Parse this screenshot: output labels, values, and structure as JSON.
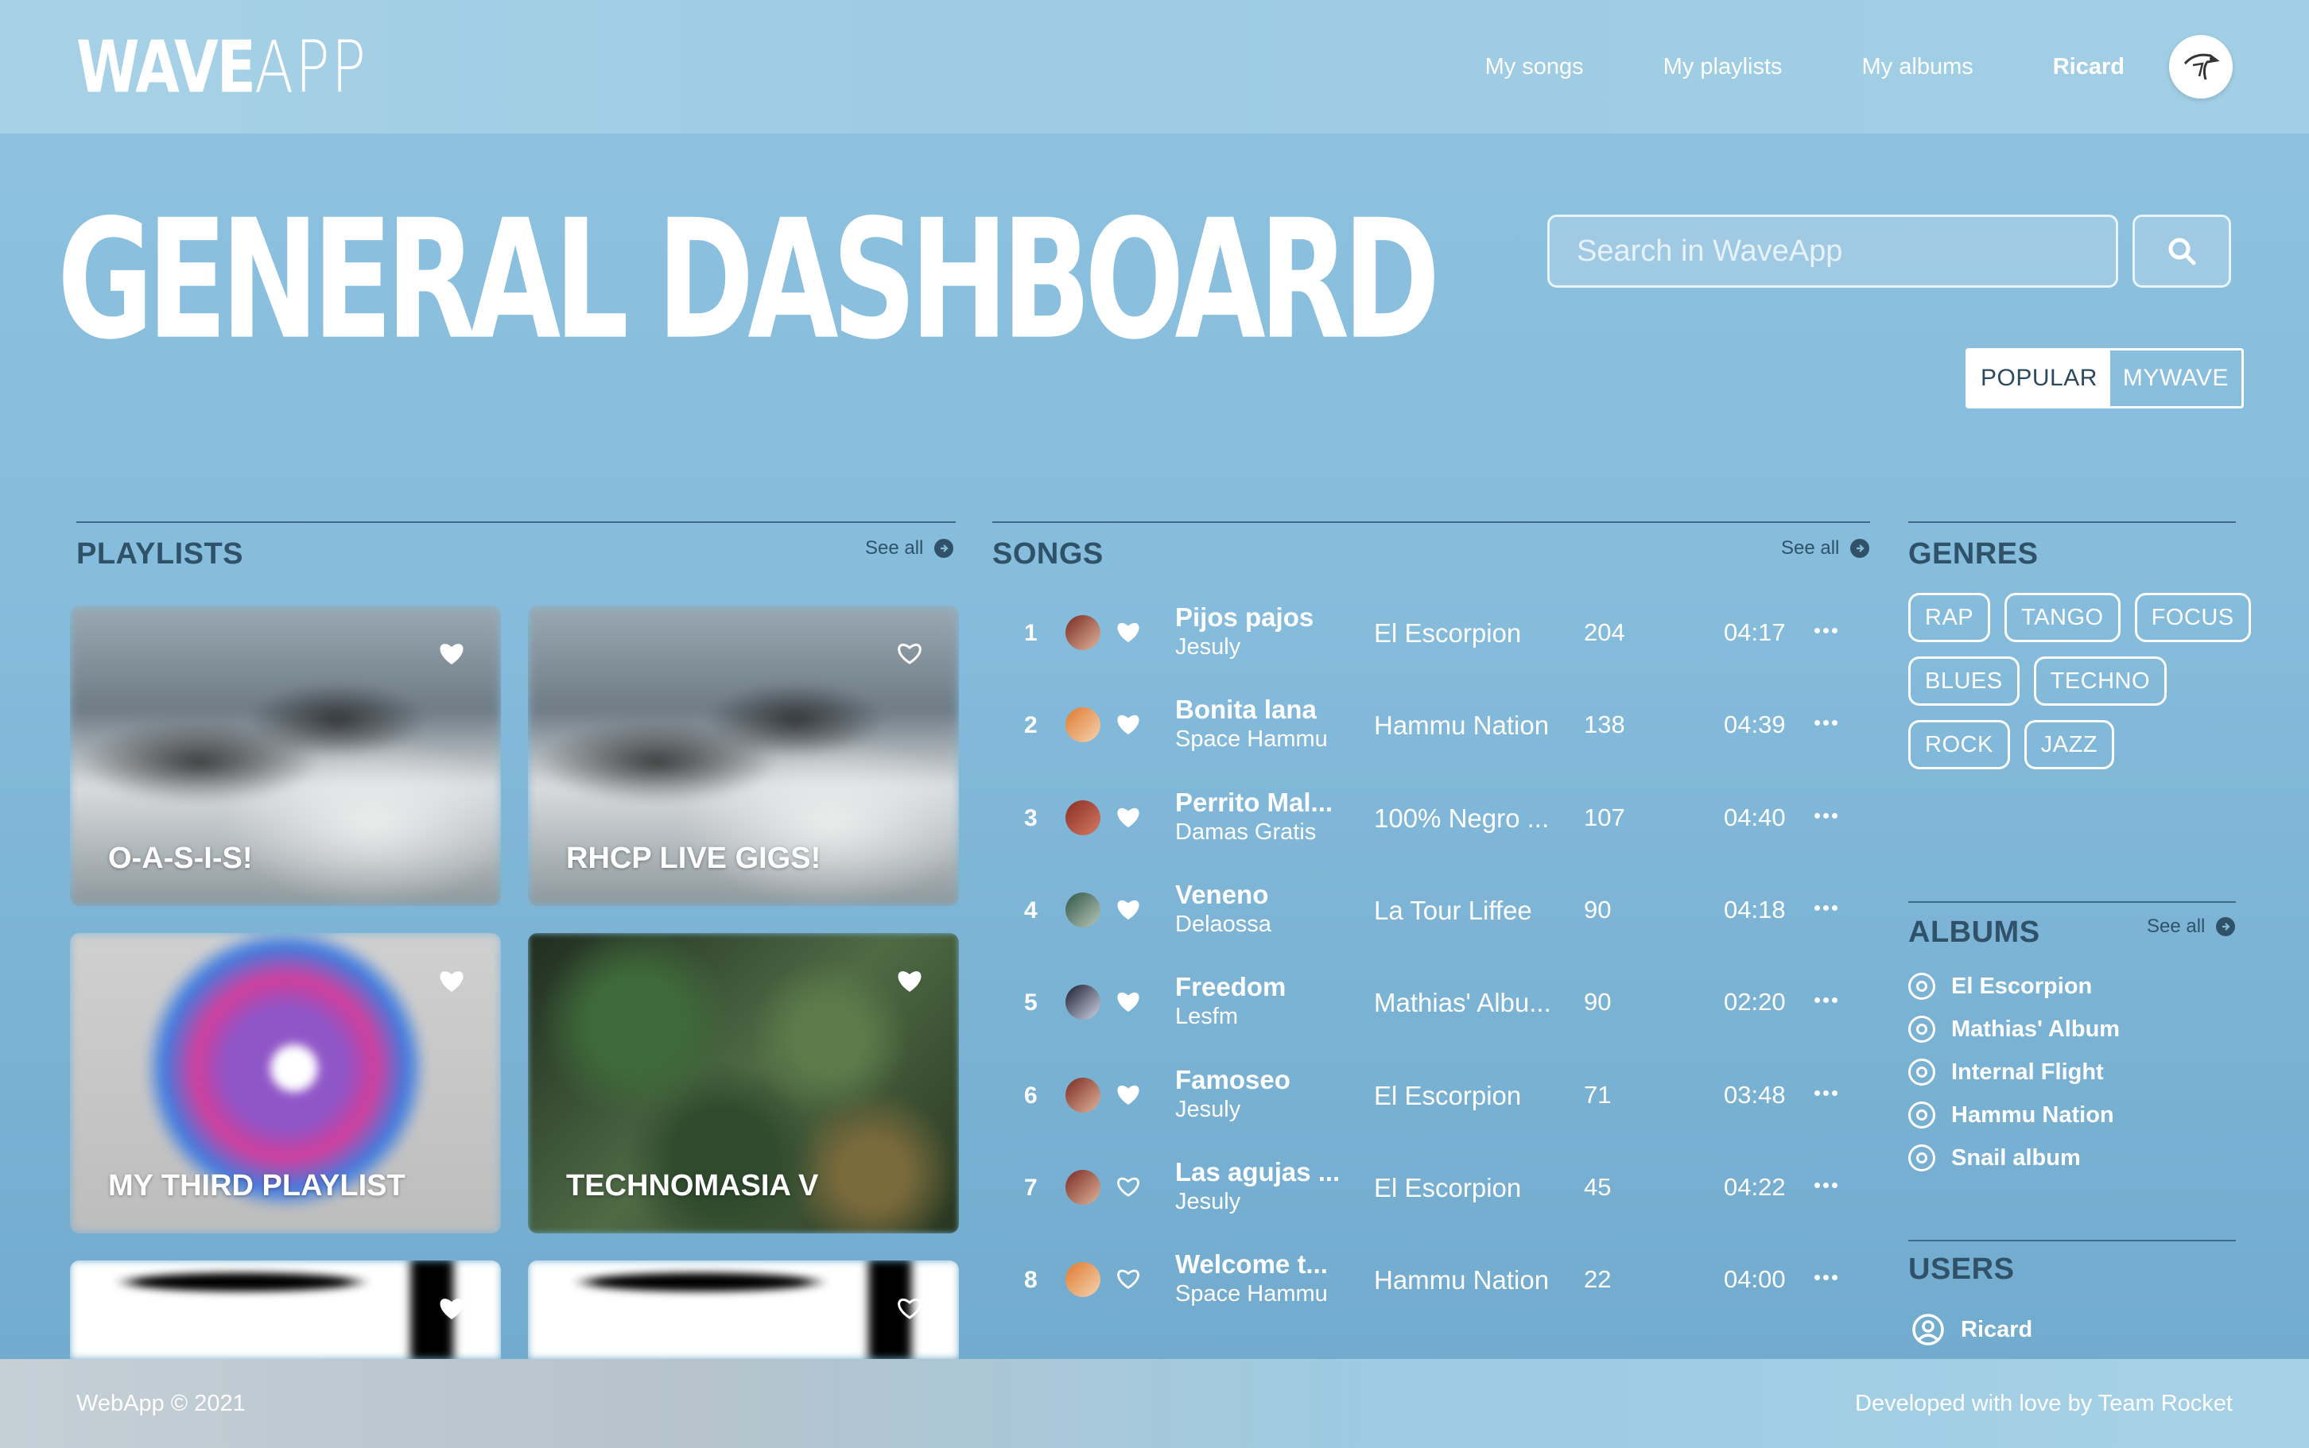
{
  "header": {
    "logo_bold": "WAVE",
    "logo_thin": "APP",
    "nav": [
      "My songs",
      "My playlists",
      "My albums"
    ],
    "user_name": "Ricard"
  },
  "hero": {
    "title": "GENERAL DASHBOARD",
    "search_placeholder": "Search in WaveApp",
    "toggle": [
      "POPULAR",
      "MYWAVE"
    ],
    "toggle_active": "POPULAR"
  },
  "playlists": {
    "title": "PLAYLISTS",
    "see_all": "See all",
    "items": [
      {
        "name": "O-A-S-I-S!",
        "liked": true
      },
      {
        "name": "RHCP LIVE GIGS!",
        "liked": false
      },
      {
        "name": "MY THIRD PLAYLIST",
        "liked": true
      },
      {
        "name": "TECHNOMASIA V",
        "liked": true
      },
      {
        "name": "",
        "liked": true
      },
      {
        "name": "",
        "liked": false
      }
    ]
  },
  "songs": {
    "title": "SONGS",
    "see_all": "See all",
    "items": [
      {
        "rank": "1",
        "title": "Pijos pajos",
        "artist": "Jesuly",
        "album": "El Escorpion",
        "plays": "204",
        "duration": "04:17",
        "liked": true
      },
      {
        "rank": "2",
        "title": "Bonita lana",
        "artist": "Space Hammu",
        "album": "Hammu Nation",
        "plays": "138",
        "duration": "04:39",
        "liked": true
      },
      {
        "rank": "3",
        "title": "Perrito Mal...",
        "artist": "Damas Gratis",
        "album": "100% Negro ...",
        "plays": "107",
        "duration": "04:40",
        "liked": true
      },
      {
        "rank": "4",
        "title": "Veneno",
        "artist": "Delaossa",
        "album": "La Tour Liffee",
        "plays": "90",
        "duration": "04:18",
        "liked": true
      },
      {
        "rank": "5",
        "title": "Freedom",
        "artist": "Lesfm",
        "album": "Mathias' Albu...",
        "plays": "90",
        "duration": "02:20",
        "liked": true
      },
      {
        "rank": "6",
        "title": "Famoseo",
        "artist": "Jesuly",
        "album": "El Escorpion",
        "plays": "71",
        "duration": "03:48",
        "liked": true
      },
      {
        "rank": "7",
        "title": "Las agujas ...",
        "artist": "Jesuly",
        "album": "El Escorpion",
        "plays": "45",
        "duration": "04:22",
        "liked": false
      },
      {
        "rank": "8",
        "title": "Welcome t...",
        "artist": "Space Hammu",
        "album": "Hammu Nation",
        "plays": "22",
        "duration": "04:00",
        "liked": false
      }
    ]
  },
  "genres": {
    "title": "GENRES",
    "items": [
      "RAP",
      "TANGO",
      "FOCUS",
      "BLUES",
      "TECHNO",
      "ROCK",
      "JAZZ"
    ]
  },
  "albums": {
    "title": "ALBUMS",
    "see_all": "See all",
    "items": [
      "El Escorpion",
      "Mathias' Album",
      "Internal Flight",
      "Hammu Nation",
      "Snail album"
    ]
  },
  "users": {
    "title": "USERS",
    "items": [
      "Ricard"
    ]
  },
  "footer": {
    "left": "WebApp © 2021",
    "right": "Developed with love by Team Rocket"
  },
  "colors": {
    "background": "#86bcdc",
    "header": "#a2cfe5",
    "section_title": "#2f5269",
    "accent_text": "#ffffff"
  }
}
